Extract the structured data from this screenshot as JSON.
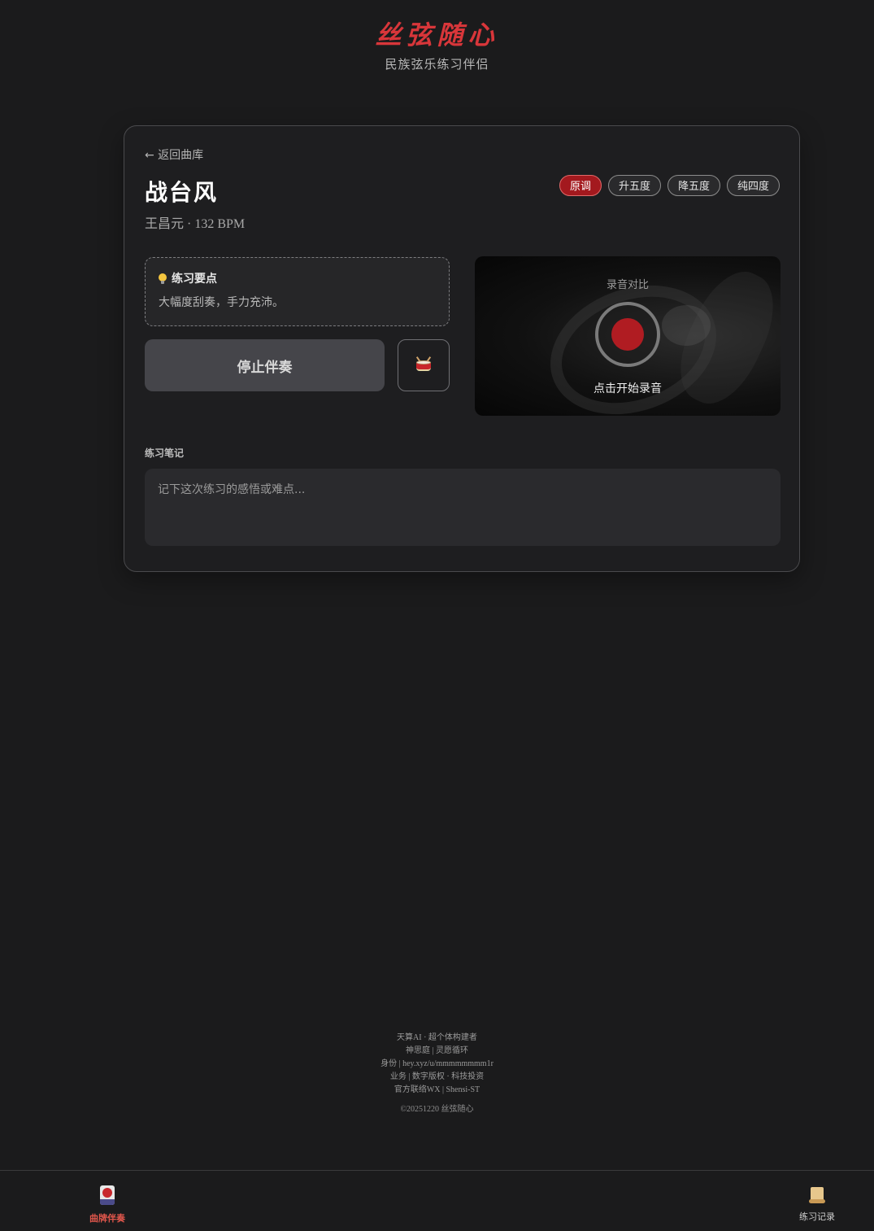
{
  "header": {
    "logo": "丝弦随心",
    "subtitle": "民族弦乐练习伴侣"
  },
  "song": {
    "back_label": "← 返回曲库",
    "title": "战台风",
    "meta": "王昌元 · 132 BPM",
    "keys": [
      "原调",
      "升五度",
      "降五度",
      "纯四度"
    ],
    "active_key": "原调"
  },
  "tips": {
    "heading": "练习要点",
    "text": "大幅度刮奏，手力充沛。"
  },
  "controls": {
    "stop_label": "停止伴奏",
    "drum_icon": "drum-icon"
  },
  "record": {
    "label": "录音对比",
    "cta": "点击开始录音"
  },
  "notes": {
    "label": "练习笔记",
    "placeholder": "记下这次练习的感悟或难点..."
  },
  "footer": {
    "lines": [
      "天算AI · 超个体构建者",
      "神思庭 | 灵愿循环",
      "身份 | hey.xyz/u/mmmmmmmm1r",
      "业务 | 数字版权 · 科技投资",
      "官方联络WX | Shensi-ST"
    ],
    "copyright": "©20251220 丝弦随心"
  },
  "nav": {
    "items": [
      {
        "label": "曲牌伴奏",
        "icon": "card-icon",
        "active": true
      },
      {
        "label": "练习记录",
        "icon": "scroll-icon",
        "active": false
      }
    ]
  },
  "colors": {
    "accent": "#d8363a",
    "active_pill": "#a3191e",
    "record_dot": "#b01c22",
    "background": "#1b1b1c"
  }
}
